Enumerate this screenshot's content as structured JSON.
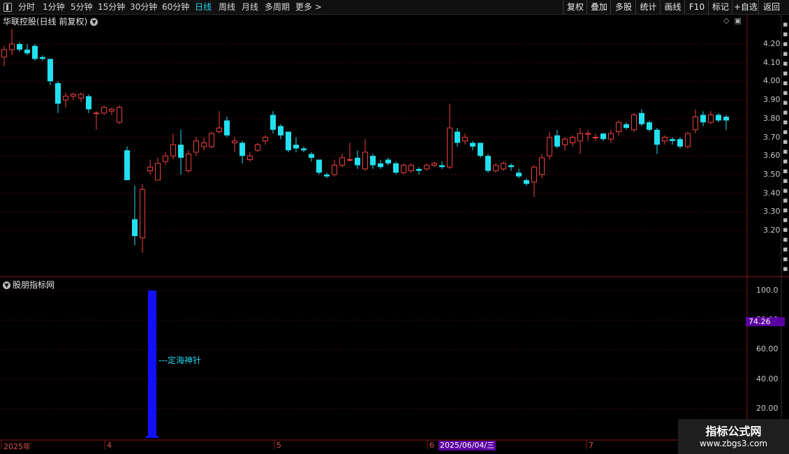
{
  "toolbar": {
    "tabs": [
      {
        "label": "分时",
        "active": false
      },
      {
        "label": "1分钟",
        "active": false
      },
      {
        "label": "5分钟",
        "active": false
      },
      {
        "label": "15分钟",
        "active": false
      },
      {
        "label": "30分钟",
        "active": false
      },
      {
        "label": "60分钟",
        "active": false
      },
      {
        "label": "日线",
        "active": true
      },
      {
        "label": "周线",
        "active": false
      },
      {
        "label": "月线",
        "active": false
      },
      {
        "label": "多周期",
        "active": false
      },
      {
        "label": "更多 >",
        "active": false
      }
    ],
    "right_buttons": [
      "复权",
      "叠加",
      "多股",
      "统计",
      "画线",
      "F10",
      "标记",
      "+自选",
      "返回"
    ]
  },
  "chart_header": {
    "stock_title": "华联控股(日线 前复权)"
  },
  "indicator": {
    "title": "股朋指标网",
    "annotation": "---定海神针",
    "current_value_label": "74.26",
    "current_value": 74.26
  },
  "price_axis_labels": [
    "4.20",
    "4.10",
    "4.00",
    "3.90",
    "3.80",
    "3.70",
    "3.60",
    "3.50",
    "3.40",
    "3.30",
    "3.20"
  ],
  "indicator_axis_labels": [
    "100.0",
    "80.00",
    "60.00",
    "40.00",
    "20.00"
  ],
  "date_axis": {
    "labels": [
      "2025年",
      "4",
      "5",
      "6",
      "7"
    ],
    "cursor_date": "2025/06/04/三"
  },
  "colors": {
    "up": "#f04040",
    "down": "#22e0f0",
    "indicator_bar": "#1010ff",
    "grid": "#6a1010",
    "cursor_badge": "#5b00a0"
  },
  "watermark": {
    "line1": "指标公式网",
    "line2": "www.zbgs3.com"
  },
  "chart_data": {
    "type": "candlestick",
    "y_axis": {
      "min": 3.1,
      "max": 4.3,
      "ticks": [
        4.2,
        4.1,
        4.0,
        3.9,
        3.8,
        3.7,
        3.6,
        3.5,
        3.4,
        3.3,
        3.2
      ]
    },
    "candles": [
      [
        4.13,
        4.17,
        4.19,
        4.08
      ],
      [
        4.17,
        4.2,
        4.28,
        4.14
      ],
      [
        4.2,
        4.17,
        4.21,
        4.16
      ],
      [
        4.17,
        4.15,
        4.2,
        4.14
      ],
      [
        4.19,
        4.12,
        4.2,
        4.11
      ],
      [
        4.13,
        4.12,
        4.14,
        4.11
      ],
      [
        4.12,
        4.0,
        4.12,
        3.98
      ],
      [
        3.99,
        3.88,
        4.0,
        3.83
      ],
      [
        3.9,
        3.92,
        3.94,
        3.86
      ],
      [
        3.92,
        3.93,
        3.94,
        3.9
      ],
      [
        3.91,
        3.93,
        3.94,
        3.89
      ],
      [
        3.92,
        3.85,
        3.93,
        3.83
      ],
      [
        3.83,
        3.83,
        3.84,
        3.74
      ],
      [
        3.83,
        3.86,
        3.87,
        3.82
      ],
      [
        3.84,
        3.85,
        3.86,
        3.82
      ],
      [
        3.78,
        3.86,
        3.87,
        3.77
      ],
      [
        3.63,
        3.47,
        3.65,
        3.47
      ],
      [
        3.26,
        3.17,
        3.44,
        3.12
      ],
      [
        3.16,
        3.42,
        3.45,
        3.08
      ],
      [
        3.52,
        3.54,
        3.58,
        3.5
      ],
      [
        3.47,
        3.56,
        3.59,
        3.47
      ],
      [
        3.57,
        3.6,
        3.62,
        3.55
      ],
      [
        3.6,
        3.66,
        3.72,
        3.58
      ],
      [
        3.66,
        3.59,
        3.74,
        3.5
      ],
      [
        3.52,
        3.61,
        3.63,
        3.51
      ],
      [
        3.62,
        3.68,
        3.7,
        3.6
      ],
      [
        3.65,
        3.67,
        3.7,
        3.63
      ],
      [
        3.65,
        3.72,
        3.73,
        3.64
      ],
      [
        3.73,
        3.75,
        3.84,
        3.72
      ],
      [
        3.79,
        3.71,
        3.81,
        3.7
      ],
      [
        3.67,
        3.68,
        3.7,
        3.62
      ],
      [
        3.67,
        3.6,
        3.68,
        3.56
      ],
      [
        3.58,
        3.6,
        3.62,
        3.57
      ],
      [
        3.63,
        3.66,
        3.67,
        3.62
      ],
      [
        3.68,
        3.7,
        3.71,
        3.66
      ],
      [
        3.82,
        3.74,
        3.84,
        3.72
      ],
      [
        3.76,
        3.71,
        3.77,
        3.69
      ],
      [
        3.73,
        3.63,
        3.73,
        3.62
      ],
      [
        3.66,
        3.64,
        3.7,
        3.62
      ],
      [
        3.64,
        3.63,
        3.65,
        3.62
      ],
      [
        3.61,
        3.59,
        3.62,
        3.57
      ],
      [
        3.58,
        3.51,
        3.58,
        3.5
      ],
      [
        3.5,
        3.49,
        3.51,
        3.48
      ],
      [
        3.5,
        3.55,
        3.58,
        3.49
      ],
      [
        3.55,
        3.59,
        3.61,
        3.54
      ],
      [
        3.58,
        3.58,
        3.67,
        3.57
      ],
      [
        3.59,
        3.55,
        3.63,
        3.53
      ],
      [
        3.53,
        3.62,
        3.69,
        3.52
      ],
      [
        3.6,
        3.55,
        3.61,
        3.53
      ],
      [
        3.56,
        3.54,
        3.58,
        3.53
      ],
      [
        3.58,
        3.56,
        3.59,
        3.55
      ],
      [
        3.56,
        3.51,
        3.57,
        3.5
      ],
      [
        3.51,
        3.55,
        3.56,
        3.5
      ],
      [
        3.52,
        3.55,
        3.56,
        3.51
      ],
      [
        3.53,
        3.52,
        3.54,
        3.5
      ],
      [
        3.53,
        3.55,
        3.56,
        3.52
      ],
      [
        3.55,
        3.56,
        3.57,
        3.54
      ],
      [
        3.55,
        3.54,
        3.57,
        3.53
      ],
      [
        3.54,
        3.75,
        3.88,
        3.53
      ],
      [
        3.73,
        3.67,
        3.75,
        3.65
      ],
      [
        3.68,
        3.7,
        3.72,
        3.66
      ],
      [
        3.67,
        3.65,
        3.68,
        3.63
      ],
      [
        3.67,
        3.6,
        3.67,
        3.59
      ],
      [
        3.6,
        3.52,
        3.61,
        3.51
      ],
      [
        3.52,
        3.55,
        3.56,
        3.51
      ],
      [
        3.53,
        3.56,
        3.57,
        3.52
      ],
      [
        3.55,
        3.54,
        3.56,
        3.52
      ],
      [
        3.51,
        3.49,
        3.53,
        3.48
      ],
      [
        3.47,
        3.45,
        3.48,
        3.44
      ],
      [
        3.46,
        3.54,
        3.55,
        3.38
      ],
      [
        3.5,
        3.59,
        3.61,
        3.48
      ],
      [
        3.6,
        3.7,
        3.73,
        3.58
      ],
      [
        3.71,
        3.65,
        3.74,
        3.64
      ],
      [
        3.66,
        3.69,
        3.7,
        3.63
      ],
      [
        3.67,
        3.7,
        3.71,
        3.65
      ],
      [
        3.68,
        3.72,
        3.75,
        3.61
      ],
      [
        3.72,
        3.72,
        3.74,
        3.68
      ],
      [
        3.7,
        3.7,
        3.72,
        3.68
      ],
      [
        3.72,
        3.69,
        3.72,
        3.68
      ],
      [
        3.69,
        3.72,
        3.74,
        3.67
      ],
      [
        3.73,
        3.78,
        3.79,
        3.71
      ],
      [
        3.77,
        3.75,
        3.78,
        3.74
      ],
      [
        3.74,
        3.82,
        3.83,
        3.73
      ],
      [
        3.83,
        3.77,
        3.85,
        3.76
      ],
      [
        3.78,
        3.74,
        3.79,
        3.73
      ],
      [
        3.74,
        3.66,
        3.75,
        3.61
      ],
      [
        3.68,
        3.7,
        3.71,
        3.66
      ],
      [
        3.69,
        3.68,
        3.7,
        3.66
      ],
      [
        3.69,
        3.65,
        3.7,
        3.64
      ],
      [
        3.65,
        3.72,
        3.73,
        3.64
      ],
      [
        3.74,
        3.81,
        3.85,
        3.72
      ],
      [
        3.82,
        3.78,
        3.84,
        3.76
      ],
      [
        3.78,
        3.82,
        3.84,
        3.77
      ],
      [
        3.82,
        3.79,
        3.83,
        3.78
      ],
      [
        3.81,
        3.79,
        3.82,
        3.74
      ]
    ],
    "indicator_signal": {
      "index": 19,
      "value": 100.0,
      "label": "定海神针"
    },
    "indicator_y_axis": {
      "min": 0,
      "max": 110,
      "ticks": [
        100,
        80,
        60,
        40,
        20
      ]
    }
  }
}
